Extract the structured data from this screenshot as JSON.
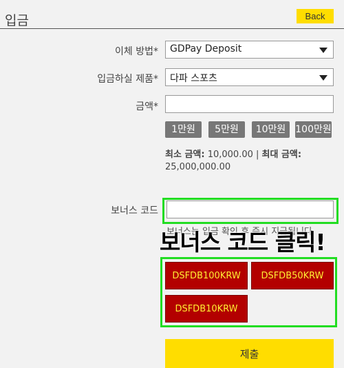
{
  "header": {
    "title": "입금",
    "back_label": "Back"
  },
  "form": {
    "transfer_method": {
      "label": "이체 방법*",
      "value": "GDPay Deposit"
    },
    "product": {
      "label": "입금하실 제품*",
      "value": "다파 스포츠"
    },
    "amount": {
      "label": "금액*",
      "value": ""
    },
    "amount_buttons": [
      "1만원",
      "5만원",
      "10만원",
      "100만원"
    ],
    "limits": {
      "min_label": "최소 금액:",
      "min_value": " 10,000.00 | ",
      "max_label": "최대 금액:",
      "max_value": "25,000,000.00"
    },
    "bonus_code": {
      "label": "보너스 코드",
      "value": "",
      "note": "보너스는 입금 확인 후 즉시 지급됩니다"
    },
    "overlay_text": "보너스 코드 클릭!",
    "bonus_codes": [
      "DSFDB100KRW",
      "DSFDB50KRW",
      "DSFDB10KRW"
    ],
    "submit_label": "제출"
  },
  "colors": {
    "accent": "#ffdd00",
    "highlight": "#22dd22",
    "bonus_bg": "#b30000",
    "bonus_text": "#ffee33"
  }
}
